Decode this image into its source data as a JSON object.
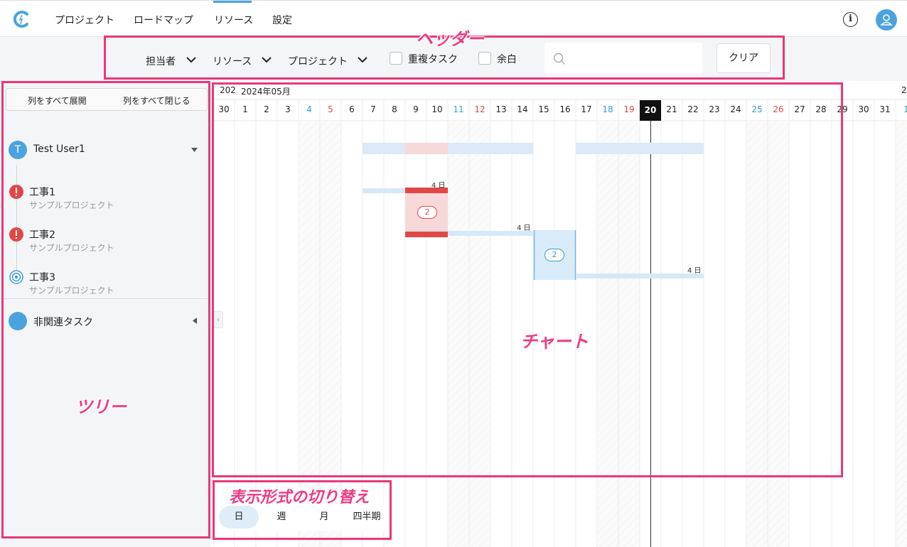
{
  "nav": {
    "items": [
      {
        "label": "プロジェクト"
      },
      {
        "label": "ロードマップ"
      },
      {
        "label": "リソース"
      },
      {
        "label": "設定"
      }
    ],
    "active_index": 2,
    "info_icon": "i"
  },
  "filters": {
    "assignee_label": "担当者",
    "resource_label": "リソース",
    "project_label": "プロジェクト",
    "duplicate_task_label": "重複タスク",
    "margin_label": "余白",
    "search_placeholder": "",
    "clear_label": "クリア"
  },
  "tree": {
    "expand_all": "列をすべて展開",
    "collapse_all": "列をすべて閉じる",
    "user": {
      "initial": "T",
      "name": "Test User1"
    },
    "tasks": [
      {
        "title": "工事1",
        "project": "サンプルプロジェクト",
        "status": "alert-icon"
      },
      {
        "title": "工事2",
        "project": "サンプルプロジェクト",
        "status": "alert-icon"
      },
      {
        "title": "工事3",
        "project": "サンプルプロジェクト",
        "status": "in-progress-icon"
      }
    ],
    "unrelated_label": "非関連タスク"
  },
  "chart": {
    "prev_month_fragment": "202",
    "month_label": "2024年05月",
    "next_month_fragment": "2",
    "days": [
      "30",
      "1",
      "2",
      "3",
      "4",
      "5",
      "6",
      "7",
      "8",
      "9",
      "10",
      "11",
      "12",
      "13",
      "14",
      "15",
      "16",
      "17",
      "18",
      "19",
      "20",
      "21",
      "22",
      "23",
      "24",
      "25",
      "26",
      "27",
      "28",
      "29",
      "30",
      "31",
      "1"
    ],
    "today": "20",
    "durations": [
      "4 日",
      "4 日",
      "4 日"
    ],
    "badges": [
      "2",
      "2"
    ],
    "colors": {
      "accent": "#4aa3df",
      "alert": "#e04848",
      "saturday": "#3a9bd5",
      "sunday": "#e04848"
    }
  },
  "view_switch": {
    "options": [
      "日",
      "週",
      "月",
      "四半期"
    ],
    "selected": "日"
  },
  "annotations": {
    "header": "ヘッダー",
    "tree": "ツリー",
    "chart": "チャート",
    "view_switch": "表示形式の切り替え"
  }
}
